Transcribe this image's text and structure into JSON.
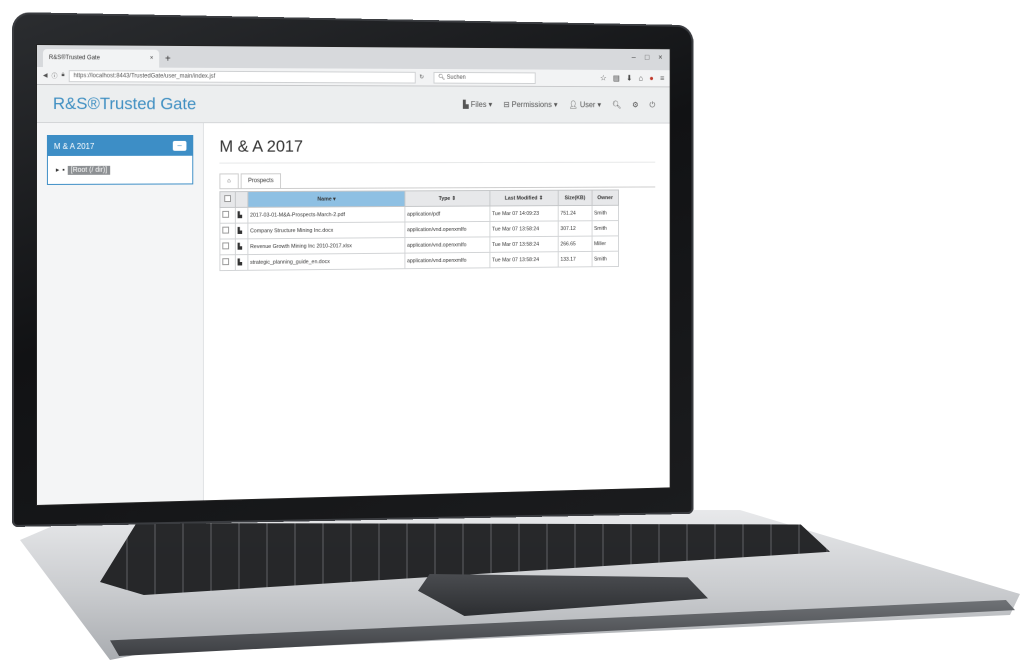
{
  "browser": {
    "tab_title": "R&S®Trusted Gate",
    "tab_close": "×",
    "new_tab": "+",
    "url": "https://localhost:8443/TrustedGate/user_main/index.jsf",
    "search_placeholder": "Suchen",
    "window_controls": [
      "–",
      "□",
      "×"
    ]
  },
  "app": {
    "brand": "R&S®Trusted Gate",
    "menu": {
      "files": "Files ▾",
      "permissions": "Permissions ▾",
      "user": "User ▾"
    }
  },
  "sidebar": {
    "panel_title": "M & A 2017",
    "collapse_label": "–",
    "tree_root": "[Root (/ dir)]"
  },
  "main": {
    "title": "M & A 2017",
    "tabs": [
      "Prospects"
    ],
    "table": {
      "headers": [
        "Name ▾",
        "Type ⇕",
        "Last Modified ⇕",
        "Size(KB)",
        "Owner"
      ],
      "rows": [
        {
          "name": "2017-03-01-M&A-Prospects-March-2.pdf",
          "type": "application/pdf",
          "modified": "Tue Mar 07 14:09:23",
          "size": "751.24",
          "owner": "Smith"
        },
        {
          "name": "Company Structure Mining Inc.docx",
          "type": "application/vnd.openxmlfo",
          "modified": "Tue Mar 07 13:58:24",
          "size": "307.12",
          "owner": "Smith"
        },
        {
          "name": "Revenue Growth Mining Inc 2010-2017.xlsx",
          "type": "application/vnd.openxmlfo",
          "modified": "Tue Mar 07 13:58:24",
          "size": "266.65",
          "owner": "Miller"
        },
        {
          "name": "strategic_planning_guide_en.docx",
          "type": "application/vnd.openxmlfo",
          "modified": "Tue Mar 07 13:58:24",
          "size": "133.17",
          "owner": "Smith"
        }
      ]
    }
  },
  "colors": {
    "brand": "#3f8fc2",
    "panel": "#3d8ec6",
    "active_header": "#8ec0e3"
  }
}
